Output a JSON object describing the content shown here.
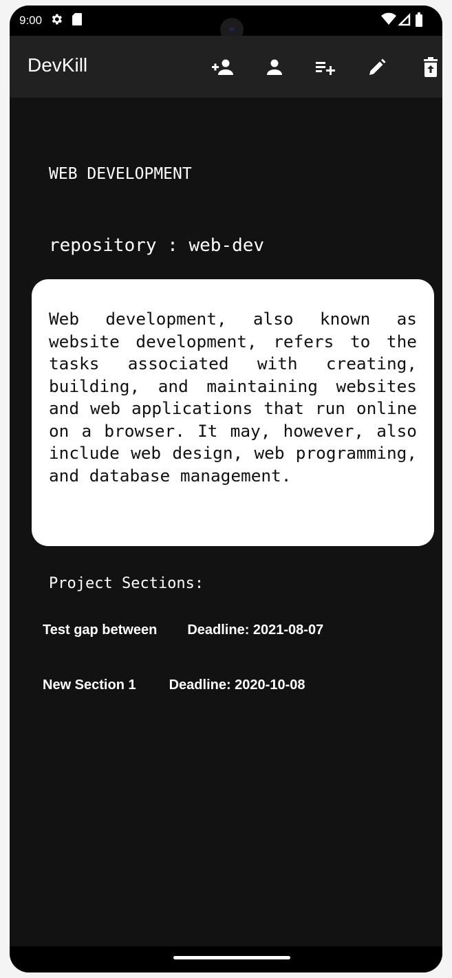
{
  "status_bar": {
    "time": "9:00",
    "left_icons": [
      "settings-icon",
      "sd-card-icon"
    ],
    "right_icons": [
      "wifi-icon",
      "signal-icon",
      "battery-icon"
    ]
  },
  "app_bar": {
    "title": "DevKill",
    "actions": [
      {
        "name": "add-person-icon"
      },
      {
        "name": "person-icon"
      },
      {
        "name": "playlist-add-icon"
      },
      {
        "name": "edit-icon"
      },
      {
        "name": "delete-icon"
      }
    ]
  },
  "project": {
    "title": "WEB DEVELOPMENT",
    "repository": "repository : web-dev",
    "description": "Web development, also known as website development, refers to the tasks associated with creating, building, and maintaining websites and web applications that run online on a browser. It may, however, also include web design, web programming, and database management."
  },
  "sections": {
    "label": "Project Sections:",
    "items": [
      {
        "name": "Test gap between",
        "deadline": "Deadline: 2021-08-07"
      },
      {
        "name": "New Section 1",
        "deadline": "Deadline: 2020-10-08"
      }
    ]
  },
  "colors": {
    "background": "#121212",
    "app_bar": "#212121",
    "card": "#ffffff",
    "text": "#ffffff"
  }
}
